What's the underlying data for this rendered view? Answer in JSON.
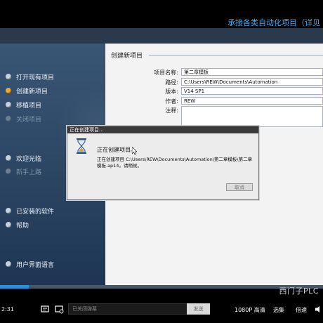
{
  "video_title": "承接各类自动化项目（详见",
  "sidebar": {
    "items": [
      {
        "label": "打开现有项目",
        "state": "normal"
      },
      {
        "label": "创建新项目",
        "state": "active"
      },
      {
        "label": "移植项目",
        "state": "normal"
      },
      {
        "label": "关闭项目",
        "state": "disabled"
      },
      {
        "label": "欢迎光临",
        "state": "normal"
      },
      {
        "label": "新手上路",
        "state": "disabled"
      },
      {
        "label": "已安装的软件",
        "state": "normal"
      },
      {
        "label": "帮助",
        "state": "normal"
      },
      {
        "label": "用户界面语言",
        "state": "normal"
      }
    ]
  },
  "create_project": {
    "section_title": "创建新项目",
    "fields": {
      "project_name": {
        "label": "项目名称:",
        "value": "第二章模板"
      },
      "path": {
        "label": "路径:",
        "value": "C:\\Users\\REW\\Documents\\Automation"
      },
      "version": {
        "label": "版本:",
        "value": "V14 SP1"
      },
      "author": {
        "label": "作者:",
        "value": "REW"
      },
      "comment": {
        "label": "注释:",
        "value": ""
      }
    }
  },
  "dialog": {
    "title": "正在创建项目...",
    "heading": "正在创建项目。",
    "message": "正在创建项目 C:\\Users\\REW\\Documents\\Automation\\第二章模板\\第二章模板.ap14。请稍候。",
    "cancel_label": "取消"
  },
  "player": {
    "watermark": "西门子PLC",
    "time": "2:31",
    "danmu_placeholder": "已关闭弹幕",
    "send_label": "发送",
    "quality": "1080P 高清",
    "episodes": "选集",
    "speed": "倍速",
    "progress": 0.09,
    "accent_color": "#2e8ed8"
  }
}
